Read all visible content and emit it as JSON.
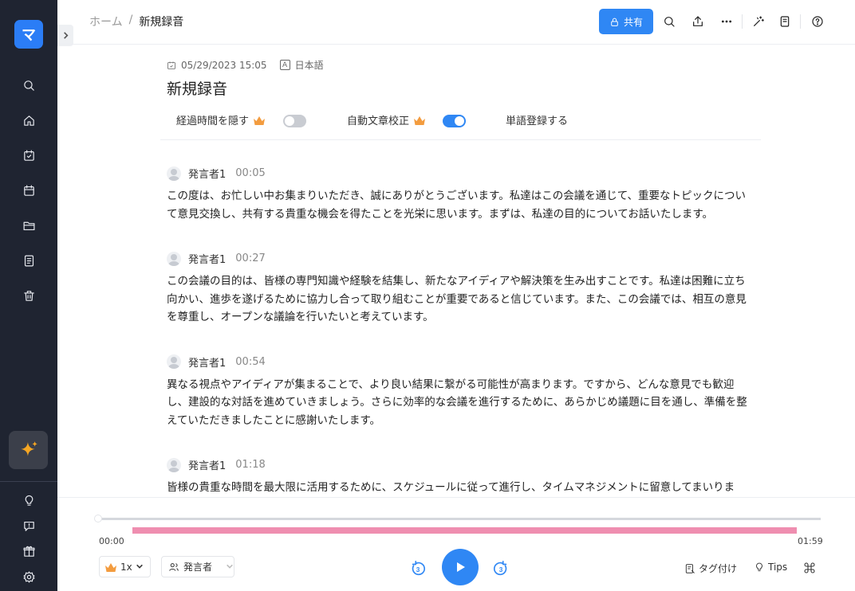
{
  "app": {
    "logo_text": "マ"
  },
  "sidebar": {
    "top_icons": [
      "search-icon",
      "home-icon",
      "calendar-check-icon",
      "calendar-icon",
      "folder-icon",
      "document-icon",
      "trash-icon"
    ],
    "bottom_icons": [
      "lightbulb-icon",
      "feedback-icon",
      "gift-icon",
      "settings-icon"
    ]
  },
  "breadcrumb": {
    "home": "ホーム",
    "separator": "/",
    "current": "新規録音"
  },
  "toolbar": {
    "share_label": "共有"
  },
  "document": {
    "date": "05/29/2023 15:05",
    "language_badge": "A",
    "language": "日本語",
    "title": "新規録音"
  },
  "options": {
    "hide_elapsed": {
      "label": "経過時間を隠す",
      "enabled": false
    },
    "auto_correct": {
      "label": "自動文章校正",
      "enabled": true
    },
    "word_register": "単語登録する"
  },
  "transcript": [
    {
      "speaker": "発言者1",
      "time": "00:05",
      "text": "この度は、お忙しい中お集まりいただき、誠にありがとうございます。私達はこの会議を通じて、重要なトピックについて意見交換し、共有する貴重な機会を得たことを光栄に思います。まずは、私達の目的についてお話いたします。"
    },
    {
      "speaker": "発言者1",
      "time": "00:27",
      "text": "この会議の目的は、皆様の専門知識や経験を結集し、新たなアイディアや解決策を生み出すことです。私達は困難に立ち向かい、進歩を遂げるために協力し合って取り組むことが重要であると信じています。また、この会議では、相互の意見を尊重し、オープンな議論を行いたいと考えています。"
    },
    {
      "speaker": "発言者1",
      "time": "00:54",
      "text": "異なる視点やアイディアが集まることで、より良い結果に繋がる可能性が高まります。ですから、どんな意見でも歓迎し、建設的な対話を進めていきましょう。さらに効率的な会議を進行するために、あらかじめ議題に目を通し、準備を整えていただきましたことに感謝いたします。"
    },
    {
      "speaker": "発言者1",
      "time": "01:18",
      "text": "皆様の貴重な時間を最大限に活用するために、スケジュールに従って進行し、タイムマネジメントに留意してまいります。最後に、この会議が成功裏に終わるためには、皆様の積極的な参加と協力が不可欠です。お互いにコミュニケーションを取りながら、実りある会議にしましょう。"
    }
  ],
  "player": {
    "current_time": "00:00",
    "total_time": "01:59",
    "progress": 0,
    "speed": "1x",
    "speaker_filter": "発言者",
    "skip_back_seconds": "3",
    "skip_forward_seconds": "3",
    "tag_label": "タグ付け",
    "tips_label": "Tips"
  },
  "colors": {
    "accent": "#2f87f4",
    "sidebar_bg": "#1f2431",
    "highlight": "#ef8eb0"
  }
}
